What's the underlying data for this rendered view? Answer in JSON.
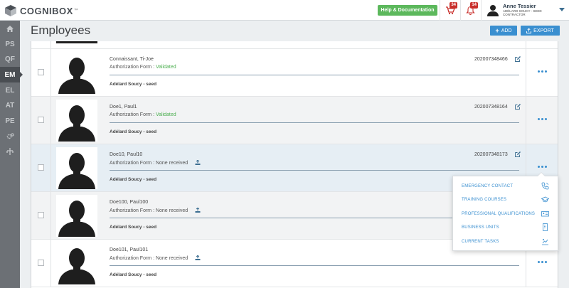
{
  "app": {
    "logo_text": "COGNIBOX",
    "logo_tm": "™",
    "help_label": "Help & Documentation",
    "cart_badge": "34",
    "bell_badge": "14",
    "user_name": "Anne Tessier",
    "user_subtitle": "ADÉLARD SOUCY - SEED CONTRACTOR"
  },
  "sidebar": {
    "items": [
      {
        "label": "",
        "icon": "home-icon"
      },
      {
        "label": "PS"
      },
      {
        "label": "QF"
      },
      {
        "label": "EM",
        "active": true
      },
      {
        "label": "EL"
      },
      {
        "label": "AT"
      },
      {
        "label": "PE"
      },
      {
        "label": "",
        "icon": "gears-icon"
      },
      {
        "label": "",
        "icon": "hierarchy-icon"
      }
    ]
  },
  "header": {
    "title": "Employees",
    "add_label": "ADD",
    "export_label": "EXPORT"
  },
  "employees": [
    {
      "name": "Connaissant, Ti-Joe",
      "auth_label": "Authorization Form : ",
      "auth_value": "Validated",
      "id": "202007348466",
      "unit": "Adélard Soucy - seed"
    },
    {
      "name": "Doe1, Paul1",
      "auth_label": "Authorization Form : ",
      "auth_value": "Validated",
      "id": "202007348164",
      "unit": "Adélard Soucy - seed"
    },
    {
      "name": "Doe10, Paul10",
      "auth_label": "Authorization Form : None received",
      "auth_value": "",
      "id": "202007348173",
      "unit": "Adélard Soucy - seed"
    },
    {
      "name": "Doe100, Paul100",
      "auth_label": "Authorization Form : None received",
      "auth_value": "",
      "id": "",
      "unit": "Adélard Soucy - seed"
    },
    {
      "name": "Doe101, Paul101",
      "auth_label": "Authorization Form : None received",
      "auth_value": "",
      "id": "",
      "unit": "Adélard Soucy - seed"
    }
  ],
  "menu": {
    "items": [
      {
        "label": "EMERGENCY CONTACT",
        "icon": "phone-icon"
      },
      {
        "label": "TRAINING COURSES",
        "icon": "graduation-cap-icon"
      },
      {
        "label": "PROFESSIONAL QUALIFICATIONS",
        "icon": "id-card-icon"
      },
      {
        "label": "BUSINESS UNITS",
        "icon": "building-icon"
      },
      {
        "label": "CURRENT TASKS",
        "icon": "tasks-icon"
      }
    ]
  },
  "colors": {
    "accent": "#3a8fd0",
    "help_green": "#5cb85c",
    "badge_red": "#c9302c",
    "validated_green": "#4caf50",
    "sidebar": "#6c7075"
  }
}
